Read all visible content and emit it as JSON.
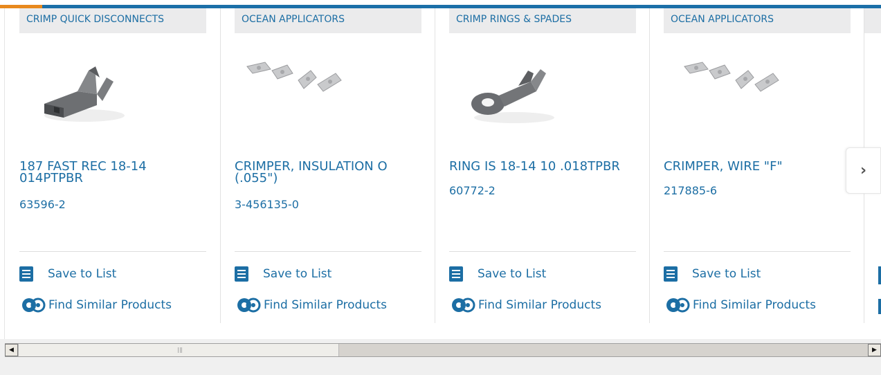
{
  "cards": [
    {
      "category": "CRIMP QUICK DISCONNECTS",
      "title": "187 FAST REC 18-14 014PTPBR",
      "part": "63596-2",
      "image": "quick-disconnect"
    },
    {
      "category": "OCEAN APPLICATORS",
      "title": "CRIMPER, INSULATION O (.055\")",
      "part": "3-456135-0",
      "image": "applicator-terminals"
    },
    {
      "category": "CRIMP RINGS & SPADES",
      "title": "RING IS 18-14 10 .018TPBR",
      "part": "60772-2",
      "image": "ring-terminal"
    },
    {
      "category": "OCEAN APPLICATORS",
      "title": "CRIMPER, WIRE \"F\"",
      "part": "217885-6",
      "image": "applicator-terminals"
    }
  ],
  "actions": {
    "save": "Save to List",
    "similar": "Find Similar Products"
  },
  "nav": {
    "next_icon": "chevron-right-icon",
    "next_glyph": "›"
  },
  "scrollbar": {
    "left_glyph": "◀",
    "right_glyph": "▶"
  },
  "colors": {
    "brand_blue": "#1c6ea4",
    "accent_orange": "#e8891d",
    "category_bg": "#ebebec"
  }
}
